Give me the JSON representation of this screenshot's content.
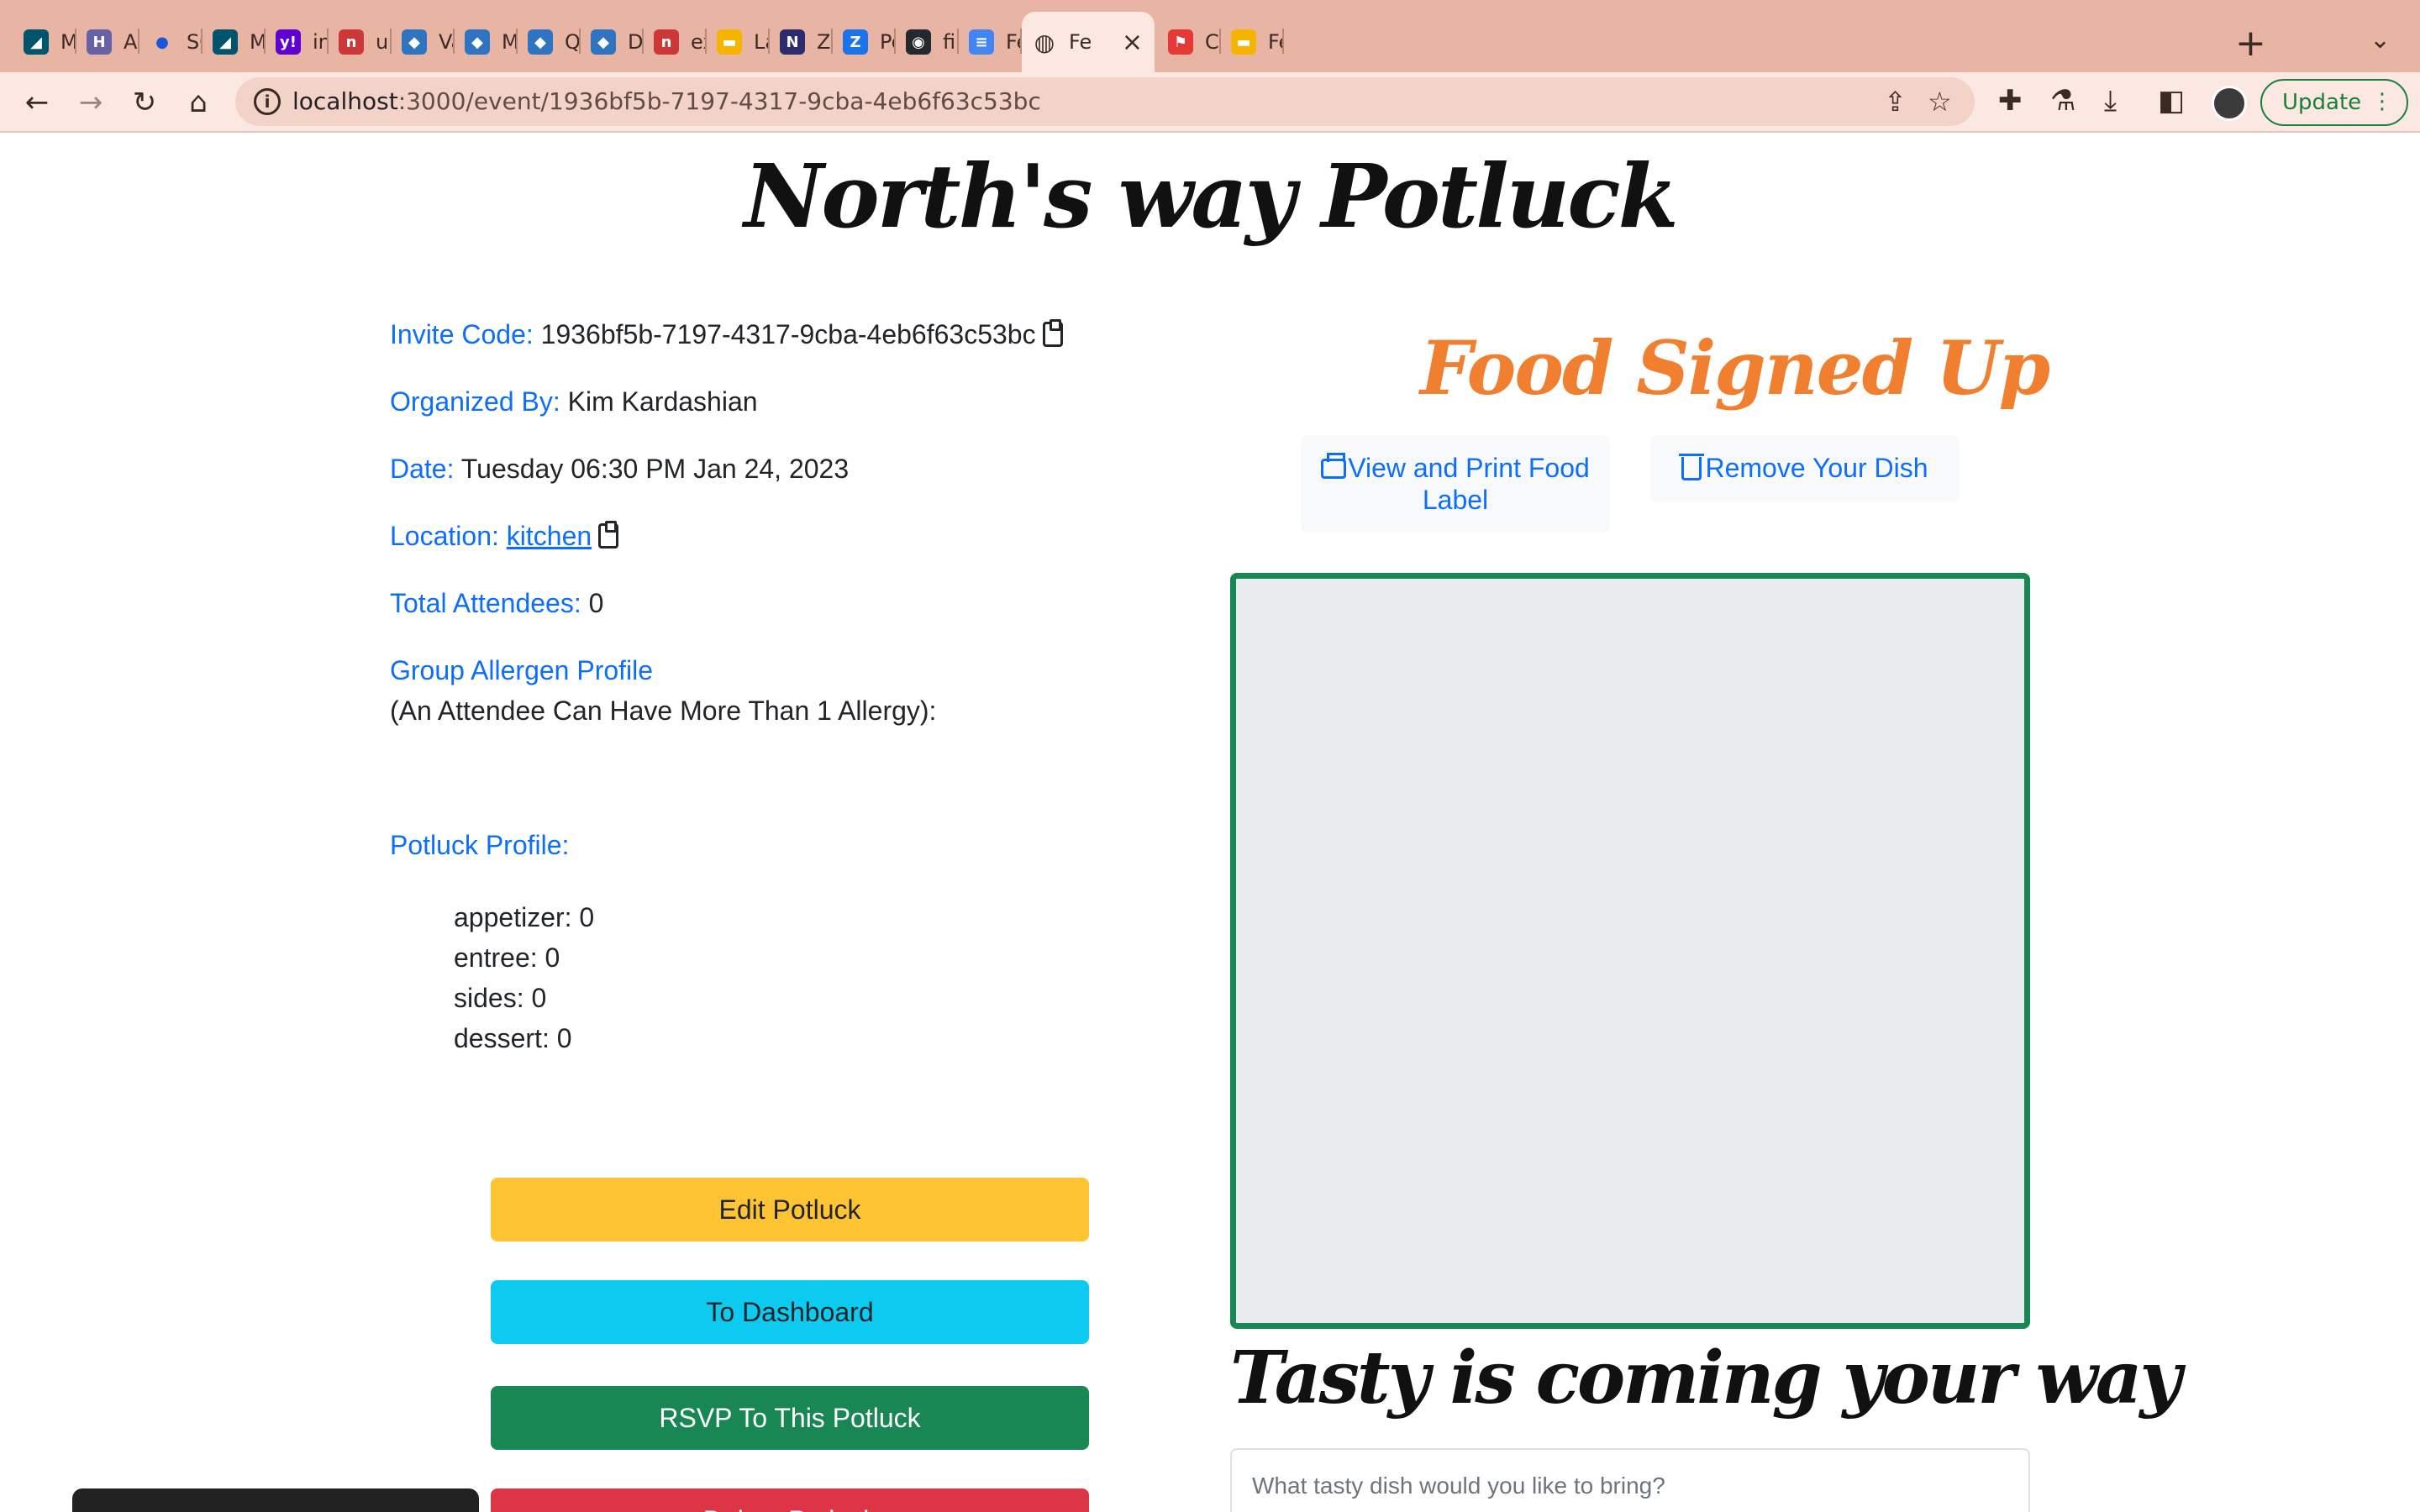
{
  "browser": {
    "tabs": [
      {
        "label": "MySQ",
        "icon": "mysql-icon",
        "color": "#00546b"
      },
      {
        "label": "Acco",
        "icon": "heroku-icon",
        "color": "#6762a6"
      },
      {
        "label": "SQL",
        "icon": "dot-icon",
        "color": "#1a56db"
      },
      {
        "label": "MySQ",
        "icon": "mysql-icon",
        "color": "#00546b"
      },
      {
        "label": "inner",
        "icon": "yahoo-icon",
        "color": "#5f01d1"
      },
      {
        "label": "uuid",
        "icon": "npm-icon",
        "color": "#cb3837"
      },
      {
        "label": "Valid",
        "icon": "cube-icon",
        "color": "#2f74c0"
      },
      {
        "label": "Mode",
        "icon": "cube-icon",
        "color": "#2f74c0"
      },
      {
        "label": "Quer",
        "icon": "cube-icon",
        "color": "#2f74c0"
      },
      {
        "label": "Data",
        "icon": "cube-icon",
        "color": "#2f74c0"
      },
      {
        "label": "expre",
        "icon": "npm-icon",
        "color": "#cb3837"
      },
      {
        "label": "Ladie",
        "icon": "slides-icon",
        "color": "#f4b400"
      },
      {
        "label": "Zoon",
        "icon": "notion-icon",
        "color": "#2c2c6c"
      },
      {
        "label": "Post",
        "icon": "z-icon",
        "color": "#1a73e8"
      },
      {
        "label": "final",
        "icon": "github-icon",
        "color": "#24292f"
      },
      {
        "label": "Feast",
        "icon": "docs-icon",
        "color": "#4285f4"
      },
      {
        "label": "Fe",
        "icon": "globe-icon",
        "color": "#3a2a26",
        "active": true
      },
      {
        "label": "Crea",
        "icon": "flag-icon",
        "color": "#e53935"
      },
      {
        "label": "Feas",
        "icon": "slides-icon",
        "color": "#f4b400"
      }
    ],
    "url_host": "localhost",
    "url_path": ":3000/event/1936bf5b-7197-4317-9cba-4eb6f63c53bc",
    "update_label": "Update"
  },
  "event": {
    "title": "North's way Potluck",
    "invite_label": "Invite Code:",
    "invite_code": "1936bf5b-7197-4317-9cba-4eb6f63c53bc",
    "organizer_label": "Organized By:",
    "organizer": "Kim Kardashian",
    "date_label": "Date:",
    "date": "Tuesday 06:30 PM Jan 24, 2023",
    "location_label": "Location:",
    "location": "kitchen",
    "attendees_label": "Total Attendees:",
    "attendees": "0",
    "allergen_label": "Group Allergen Profile",
    "allergen_note": "(An Attendee Can Have More Than 1 Allergy):",
    "profile_label": "Potluck Profile:",
    "profile": [
      {
        "text": "appetizer: 0"
      },
      {
        "text": "entree: 0"
      },
      {
        "text": "sides: 0"
      },
      {
        "text": "dessert: 0"
      }
    ]
  },
  "buttons": {
    "edit": "Edit Potluck",
    "dashboard": "To Dashboard",
    "rsvp": "RSVP To This Potluck",
    "delete": "Delete Potluck"
  },
  "food": {
    "title": "Food Signed Up",
    "print_label": "View and Print Food Label",
    "remove_label": "Remove Your Dish",
    "tasty_title": "Tasty is coming your way",
    "dish_placeholder": "What tasty dish would you like to bring?"
  },
  "colors": {
    "primary": "#0d6efd",
    "warning": "#ffc433",
    "info": "#0dcaf0",
    "success": "#198754",
    "danger": "#dc3545",
    "accent_orange": "#f07f30"
  }
}
